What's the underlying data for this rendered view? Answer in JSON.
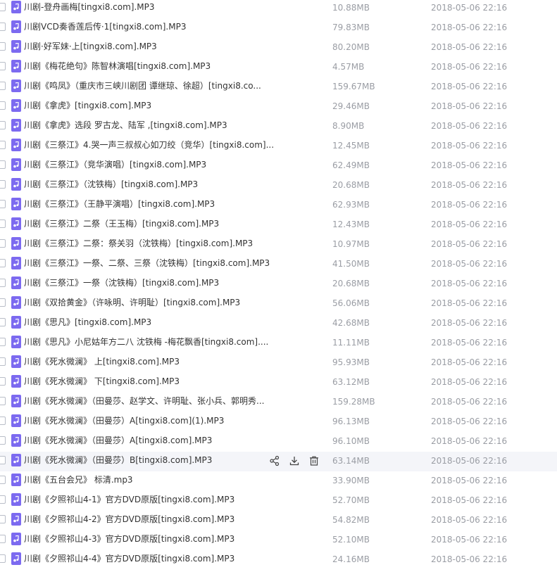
{
  "files": [
    {
      "name": "川剧-登舟画梅[tingxi8.com].MP3",
      "size": "10.88MB",
      "date": "2018-05-06 22:16"
    },
    {
      "name": "川剧VCD奏香莲后传·1[tingxi8.com].MP3",
      "size": "79.83MB",
      "date": "2018-05-06 22:16"
    },
    {
      "name": "川剧·好军妹·上[tingxi8.com].MP3",
      "size": "80.20MB",
      "date": "2018-05-06 22:16"
    },
    {
      "name": "川剧《梅花绝句》陈智林演唱[tingxi8.com].MP3",
      "size": "4.57MB",
      "date": "2018-05-06 22:16"
    },
    {
      "name": "川剧《鸣凤》（重庆市三峡川剧团 谭继琼、徐超）[tingxi8.co...",
      "size": "159.67MB",
      "date": "2018-05-06 22:16"
    },
    {
      "name": "川剧《拿虎》[tingxi8.com].MP3",
      "size": "29.46MB",
      "date": "2018-05-06 22:16"
    },
    {
      "name": "川剧《拿虎》选段 罗古龙、陆军 ,[tingxi8.com].MP3",
      "size": "8.90MB",
      "date": "2018-05-06 22:16"
    },
    {
      "name": "川剧《三祭江》4.哭一声三叔叔心如刀绞（竞华）[tingxi8.com]...",
      "size": "12.45MB",
      "date": "2018-05-06 22:16"
    },
    {
      "name": "川剧《三祭江》（竞华演唱）[tingxi8.com].MP3",
      "size": "62.49MB",
      "date": "2018-05-06 22:16"
    },
    {
      "name": "川剧《三祭江》（沈铁梅）[tingxi8.com].MP3",
      "size": "20.68MB",
      "date": "2018-05-06 22:16"
    },
    {
      "name": "川剧《三祭江》（王静平演唱）[tingxi8.com].MP3",
      "size": "62.93MB",
      "date": "2018-05-06 22:16"
    },
    {
      "name": "川剧《三祭江》二祭（王玉梅）[tingxi8.com].MP3",
      "size": "12.43MB",
      "date": "2018-05-06 22:16"
    },
    {
      "name": "川剧《三祭江》二祭：祭关羽（沈铁梅）[tingxi8.com].MP3",
      "size": "10.97MB",
      "date": "2018-05-06 22:16"
    },
    {
      "name": "川剧《三祭江》一祭、二祭、三祭（沈铁梅）[tingxi8.com].MP3",
      "size": "41.50MB",
      "date": "2018-05-06 22:16"
    },
    {
      "name": "川剧《三祭江》一祭（沈铁梅）[tingxi8.com].MP3",
      "size": "20.68MB",
      "date": "2018-05-06 22:16"
    },
    {
      "name": "川剧《双拾黄金》（许咏明、许明耻）[tingxi8.com].MP3",
      "size": "56.06MB",
      "date": "2018-05-06 22:16"
    },
    {
      "name": "川剧《思凡》[tingxi8.com].MP3",
      "size": "42.68MB",
      "date": "2018-05-06 22:16"
    },
    {
      "name": "川剧《思凡》小尼姑年方二八 沈铁梅 -梅花飘香[tingxi8.com]....",
      "size": "11.11MB",
      "date": "2018-05-06 22:16"
    },
    {
      "name": "川剧《死水微澜》 上[tingxi8.com].MP3",
      "size": "95.93MB",
      "date": "2018-05-06 22:16"
    },
    {
      "name": "川剧《死水微澜》 下[tingxi8.com].MP3",
      "size": "63.12MB",
      "date": "2018-05-06 22:16"
    },
    {
      "name": "川剧《死水微澜》（田曼莎、赵学文、许明耻、张小兵、郭明秀...",
      "size": "159.28MB",
      "date": "2018-05-06 22:16"
    },
    {
      "name": "川剧《死水微澜》（田曼莎）A[tingxi8.com](1).MP3",
      "size": "96.13MB",
      "date": "2018-05-06 22:16"
    },
    {
      "name": "川剧《死水微澜》（田曼莎）A[tingxi8.com].MP3",
      "size": "96.10MB",
      "date": "2018-05-06 22:16"
    },
    {
      "name": "川剧《死水微澜》（田曼莎）B[tingxi8.com].MP3",
      "size": "63.14MB",
      "date": "2018-05-06 22:16",
      "hovered": true
    },
    {
      "name": "川剧《五台会兄》 标清.mp3",
      "size": "33.90MB",
      "date": "2018-05-06 22:16"
    },
    {
      "name": "川剧《夕照祁山4-1》官方DVD原版[tingxi8.com].MP3",
      "size": "52.70MB",
      "date": "2018-05-06 22:16"
    },
    {
      "name": "川剧《夕照祁山4-2》官方DVD原版[tingxi8.com].MP3",
      "size": "54.82MB",
      "date": "2018-05-06 22:16"
    },
    {
      "name": "川剧《夕照祁山4-3》官方DVD原版[tingxi8.com].MP3",
      "size": "52.10MB",
      "date": "2018-05-06 22:16"
    },
    {
      "name": "川剧《夕照祁山4-4》官方DVD原版[tingxi8.com].MP3",
      "size": "24.16MB",
      "date": "2018-05-06 22:16"
    }
  ],
  "icons": {
    "file": "audio-file-icon",
    "share": "share-icon",
    "download": "download-icon",
    "delete": "trash-icon"
  },
  "colors": {
    "file_icon": "#7c6af0",
    "hover_row": "#f4f5f9",
    "meta_text": "#9a9da4"
  }
}
